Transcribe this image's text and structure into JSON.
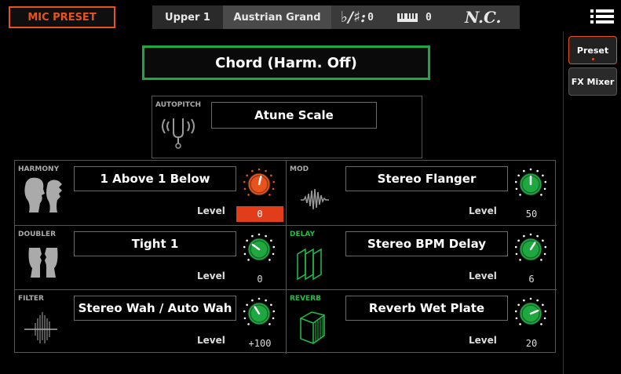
{
  "header": {
    "page_title": "MIC PRESET",
    "track": "Upper 1",
    "sound": "Austrian Grand",
    "transpose_symbol": "♭/♯:",
    "transpose_value": "0",
    "keyboard_value": "0",
    "chord": "N.C."
  },
  "side_tabs": [
    {
      "label": "Preset",
      "selected": true
    },
    {
      "label": "FX Mixer",
      "selected": false
    }
  ],
  "preset_name": "Chord (Harm. Off)",
  "autopitch": {
    "label": "AUTOPITCH",
    "value": "Atune Scale"
  },
  "level_label": "Level",
  "effects": [
    {
      "label": "HARMONY",
      "value": "1 Above 1 Below",
      "level": "0",
      "knob_level": 0.55,
      "knob_color": "#e8531d",
      "highlighted": true
    },
    {
      "label": "MOD",
      "value": "Stereo Flanger",
      "level": "50",
      "knob_level": 0.5,
      "knob_color": "#1fa740",
      "highlighted": false
    },
    {
      "label": "DOUBLER",
      "value": "Tight 1",
      "level": "0",
      "knob_level": 0.3,
      "knob_color": "#1fa740",
      "highlighted": false
    },
    {
      "label": "DELAY",
      "value": "Stereo BPM Delay",
      "level": "6",
      "knob_level": 0.62,
      "knob_color": "#1fa740",
      "highlighted": false
    },
    {
      "label": "FILTER",
      "value": "Stereo Wah / Auto Wah",
      "level": "+100",
      "knob_level": 0.38,
      "knob_color": "#1fa740",
      "highlighted": false
    },
    {
      "label": "REVERB",
      "value": "Reverb Wet Plate",
      "level": "20",
      "knob_level": 0.75,
      "knob_color": "#1fa740",
      "highlighted": false
    }
  ],
  "colors": {
    "accent": "#e8531d",
    "active_green": "#1fa740",
    "label_green": "#1fbf4a"
  },
  "icons": {
    "menu": "hamburger-menu-icon",
    "keyboard": "keyboard-icon",
    "autopitch": "tuning-fork-icon"
  }
}
